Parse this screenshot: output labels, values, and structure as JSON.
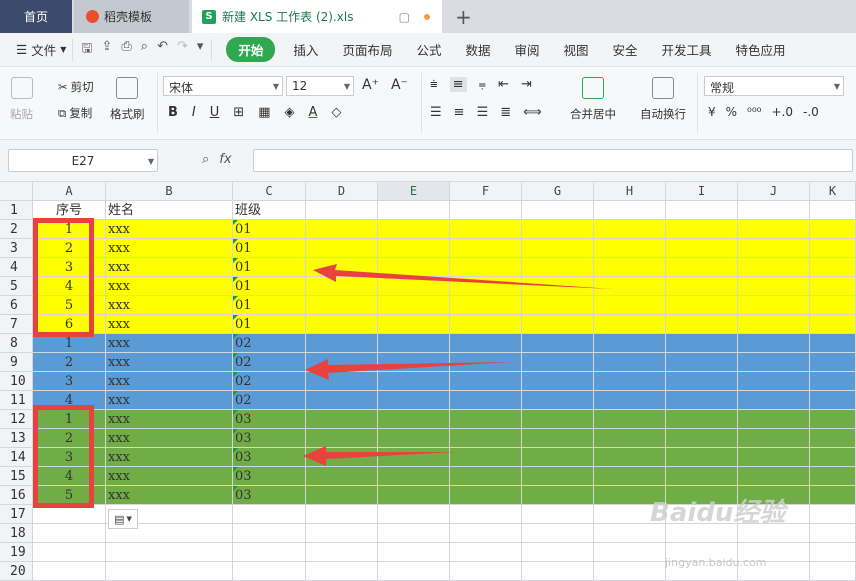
{
  "tabs": {
    "home": "首页",
    "docer": "稻壳模板",
    "file": "新建 XLS 工作表 (2).xls",
    "new_tab": "+"
  },
  "menu": {
    "file": "文件",
    "items": [
      "开始",
      "插入",
      "页面布局",
      "公式",
      "数据",
      "审阅",
      "视图",
      "安全",
      "开发工具",
      "特色应用"
    ]
  },
  "ribbon": {
    "paste": "粘贴",
    "cut": "剪切",
    "copy": "复制",
    "format_painter": "格式刷",
    "font_name": "宋体",
    "font_size": "12",
    "merge_center": "合并居中",
    "wrap_text": "自动换行",
    "number_format": "常规"
  },
  "formula_bar": {
    "name_box": "E27",
    "fx_label": "fx",
    "formula_value": ""
  },
  "sheet": {
    "columns": [
      "A",
      "B",
      "C",
      "D",
      "E",
      "F",
      "G",
      "H",
      "I",
      "J",
      "K"
    ],
    "selected_column": "E",
    "row_numbers": [
      "1",
      "2",
      "3",
      "4",
      "5",
      "6",
      "7",
      "8",
      "9",
      "10",
      "11",
      "12",
      "13",
      "14",
      "15",
      "16",
      "17",
      "18",
      "19",
      "20"
    ],
    "header_row": {
      "A": "序号",
      "B": "姓名",
      "C": "班级"
    },
    "rows": [
      {
        "A": "1",
        "B": "xxx",
        "C": "01",
        "fill": "#ffff00"
      },
      {
        "A": "2",
        "B": "xxx",
        "C": "01",
        "fill": "#ffff00"
      },
      {
        "A": "3",
        "B": "xxx",
        "C": "01",
        "fill": "#ffff00"
      },
      {
        "A": "4",
        "B": "xxx",
        "C": "01",
        "fill": "#ffff00"
      },
      {
        "A": "5",
        "B": "xxx",
        "C": "01",
        "fill": "#ffff00"
      },
      {
        "A": "6",
        "B": "xxx",
        "C": "01",
        "fill": "#ffff00"
      },
      {
        "A": "1",
        "B": "xxx",
        "C": "02",
        "fill": "#5b9bd5"
      },
      {
        "A": "2",
        "B": "xxx",
        "C": "02",
        "fill": "#5b9bd5"
      },
      {
        "A": "3",
        "B": "xxx",
        "C": "02",
        "fill": "#5b9bd5"
      },
      {
        "A": "4",
        "B": "xxx",
        "C": "02",
        "fill": "#5b9bd5"
      },
      {
        "A": "1",
        "B": "xxx",
        "C": "03",
        "fill": "#70ad47"
      },
      {
        "A": "2",
        "B": "xxx",
        "C": "03",
        "fill": "#70ad47"
      },
      {
        "A": "3",
        "B": "xxx",
        "C": "03",
        "fill": "#70ad47"
      },
      {
        "A": "4",
        "B": "xxx",
        "C": "03",
        "fill": "#70ad47"
      },
      {
        "A": "5",
        "B": "xxx",
        "C": "03",
        "fill": "#70ad47"
      }
    ]
  },
  "annotation_color": "#e8423f",
  "watermark": {
    "logo": "Baidu经验",
    "url": "jingyan.baidu.com"
  }
}
